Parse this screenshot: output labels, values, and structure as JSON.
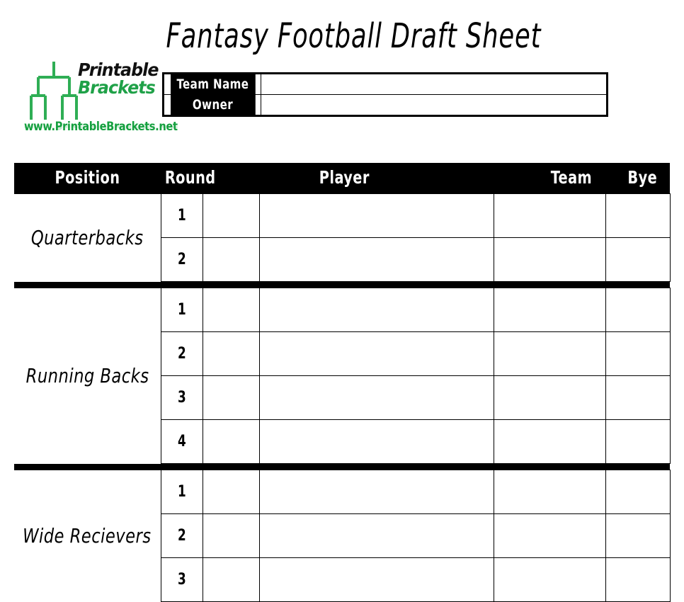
{
  "page": {
    "title": "Fantasy Football Draft Sheet"
  },
  "logo": {
    "icon_name": "bracket-tree-icon",
    "word1": "Printable",
    "word2": "Brackets",
    "url": "www.PrintableBrackets.net",
    "colors": {
      "word1": "#111111",
      "word2": "#1fa148",
      "url": "#15a03f",
      "icon": "#2fae55"
    }
  },
  "team_info": {
    "team_name_label": "Team Name",
    "team_name_value": "",
    "owner_label": "Owner",
    "owner_value": ""
  },
  "table": {
    "headers": {
      "position": "Position",
      "round": "Round",
      "player": "Player",
      "team": "Team",
      "bye": "Bye"
    },
    "sections": [
      {
        "position": "Quarterbacks",
        "rounds": [
          "1",
          "2"
        ]
      },
      {
        "position": "Running Backs",
        "rounds": [
          "1",
          "2",
          "3",
          "4"
        ]
      },
      {
        "position": "Wide Recievers",
        "rounds": [
          "1",
          "2",
          "3"
        ]
      }
    ]
  }
}
